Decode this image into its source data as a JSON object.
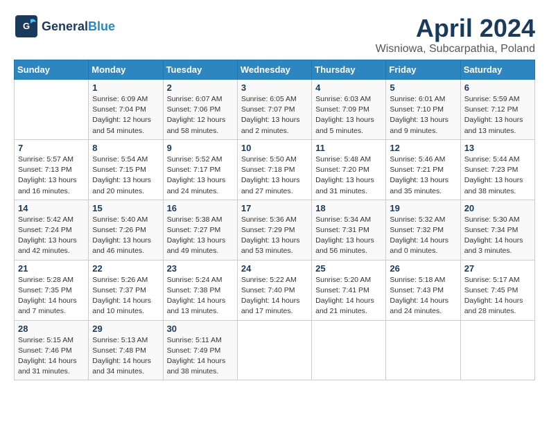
{
  "logo": {
    "part1": "General",
    "part2": "Blue"
  },
  "title": "April 2024",
  "location": "Wisniowa, Subcarpathia, Poland",
  "days_header": [
    "Sunday",
    "Monday",
    "Tuesday",
    "Wednesday",
    "Thursday",
    "Friday",
    "Saturday"
  ],
  "weeks": [
    [
      {
        "num": "",
        "info": ""
      },
      {
        "num": "1",
        "info": "Sunrise: 6:09 AM\nSunset: 7:04 PM\nDaylight: 12 hours\nand 54 minutes."
      },
      {
        "num": "2",
        "info": "Sunrise: 6:07 AM\nSunset: 7:06 PM\nDaylight: 12 hours\nand 58 minutes."
      },
      {
        "num": "3",
        "info": "Sunrise: 6:05 AM\nSunset: 7:07 PM\nDaylight: 13 hours\nand 2 minutes."
      },
      {
        "num": "4",
        "info": "Sunrise: 6:03 AM\nSunset: 7:09 PM\nDaylight: 13 hours\nand 5 minutes."
      },
      {
        "num": "5",
        "info": "Sunrise: 6:01 AM\nSunset: 7:10 PM\nDaylight: 13 hours\nand 9 minutes."
      },
      {
        "num": "6",
        "info": "Sunrise: 5:59 AM\nSunset: 7:12 PM\nDaylight: 13 hours\nand 13 minutes."
      }
    ],
    [
      {
        "num": "7",
        "info": "Sunrise: 5:57 AM\nSunset: 7:13 PM\nDaylight: 13 hours\nand 16 minutes."
      },
      {
        "num": "8",
        "info": "Sunrise: 5:54 AM\nSunset: 7:15 PM\nDaylight: 13 hours\nand 20 minutes."
      },
      {
        "num": "9",
        "info": "Sunrise: 5:52 AM\nSunset: 7:17 PM\nDaylight: 13 hours\nand 24 minutes."
      },
      {
        "num": "10",
        "info": "Sunrise: 5:50 AM\nSunset: 7:18 PM\nDaylight: 13 hours\nand 27 minutes."
      },
      {
        "num": "11",
        "info": "Sunrise: 5:48 AM\nSunset: 7:20 PM\nDaylight: 13 hours\nand 31 minutes."
      },
      {
        "num": "12",
        "info": "Sunrise: 5:46 AM\nSunset: 7:21 PM\nDaylight: 13 hours\nand 35 minutes."
      },
      {
        "num": "13",
        "info": "Sunrise: 5:44 AM\nSunset: 7:23 PM\nDaylight: 13 hours\nand 38 minutes."
      }
    ],
    [
      {
        "num": "14",
        "info": "Sunrise: 5:42 AM\nSunset: 7:24 PM\nDaylight: 13 hours\nand 42 minutes."
      },
      {
        "num": "15",
        "info": "Sunrise: 5:40 AM\nSunset: 7:26 PM\nDaylight: 13 hours\nand 46 minutes."
      },
      {
        "num": "16",
        "info": "Sunrise: 5:38 AM\nSunset: 7:27 PM\nDaylight: 13 hours\nand 49 minutes."
      },
      {
        "num": "17",
        "info": "Sunrise: 5:36 AM\nSunset: 7:29 PM\nDaylight: 13 hours\nand 53 minutes."
      },
      {
        "num": "18",
        "info": "Sunrise: 5:34 AM\nSunset: 7:31 PM\nDaylight: 13 hours\nand 56 minutes."
      },
      {
        "num": "19",
        "info": "Sunrise: 5:32 AM\nSunset: 7:32 PM\nDaylight: 14 hours\nand 0 minutes."
      },
      {
        "num": "20",
        "info": "Sunrise: 5:30 AM\nSunset: 7:34 PM\nDaylight: 14 hours\nand 3 minutes."
      }
    ],
    [
      {
        "num": "21",
        "info": "Sunrise: 5:28 AM\nSunset: 7:35 PM\nDaylight: 14 hours\nand 7 minutes."
      },
      {
        "num": "22",
        "info": "Sunrise: 5:26 AM\nSunset: 7:37 PM\nDaylight: 14 hours\nand 10 minutes."
      },
      {
        "num": "23",
        "info": "Sunrise: 5:24 AM\nSunset: 7:38 PM\nDaylight: 14 hours\nand 13 minutes."
      },
      {
        "num": "24",
        "info": "Sunrise: 5:22 AM\nSunset: 7:40 PM\nDaylight: 14 hours\nand 17 minutes."
      },
      {
        "num": "25",
        "info": "Sunrise: 5:20 AM\nSunset: 7:41 PM\nDaylight: 14 hours\nand 21 minutes."
      },
      {
        "num": "26",
        "info": "Sunrise: 5:18 AM\nSunset: 7:43 PM\nDaylight: 14 hours\nand 24 minutes."
      },
      {
        "num": "27",
        "info": "Sunrise: 5:17 AM\nSunset: 7:45 PM\nDaylight: 14 hours\nand 28 minutes."
      }
    ],
    [
      {
        "num": "28",
        "info": "Sunrise: 5:15 AM\nSunset: 7:46 PM\nDaylight: 14 hours\nand 31 minutes."
      },
      {
        "num": "29",
        "info": "Sunrise: 5:13 AM\nSunset: 7:48 PM\nDaylight: 14 hours\nand 34 minutes."
      },
      {
        "num": "30",
        "info": "Sunrise: 5:11 AM\nSunset: 7:49 PM\nDaylight: 14 hours\nand 38 minutes."
      },
      {
        "num": "",
        "info": ""
      },
      {
        "num": "",
        "info": ""
      },
      {
        "num": "",
        "info": ""
      },
      {
        "num": "",
        "info": ""
      }
    ]
  ]
}
